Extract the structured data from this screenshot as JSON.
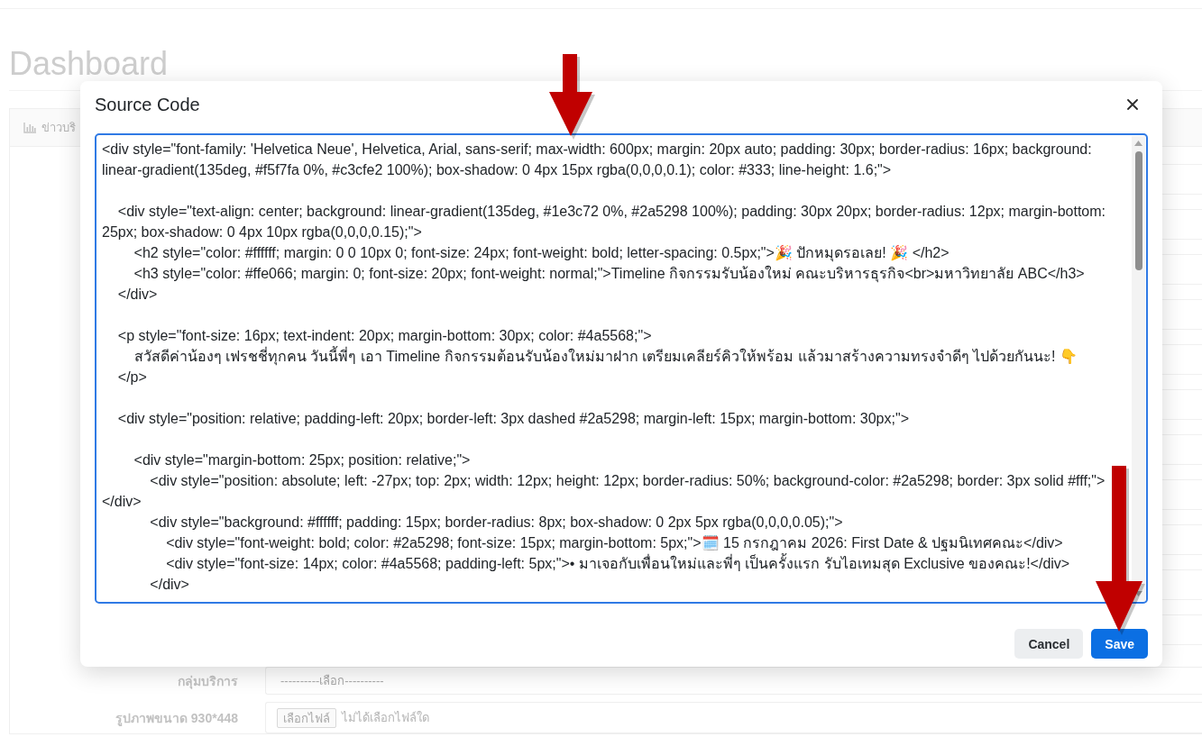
{
  "page": {
    "title": "Dashboard"
  },
  "card": {
    "tab": "ข่าวบริ"
  },
  "form": {
    "rows": [
      {
        "kind": "select",
        "label": "กลุ่มบริการ",
        "value": "----------เลือก----------"
      },
      {
        "kind": "file",
        "label": "รูปภาพขนาด 930*448",
        "button": "เลือกไฟล์",
        "status": "ไม่ได้เลือกไฟล์ใด"
      }
    ]
  },
  "dialog": {
    "title": "Source Code",
    "code_blocks": [
      [
        "<div style=\"font-family: 'Helvetica Neue', Helvetica, Arial, sans-serif; max-width: 600px; margin: 20px auto; padding: 30px; border-radius: 16px; background: linear-gradient(135deg, #f5f7fa 0%, #c3cfe2 100%); box-shadow: 0 4px 15px rgba(0,0,0,0.1); color: #333; line-height: 1.6;\">"
      ],
      [
        "    <div style=\"text-align: center; background: linear-gradient(135deg, #1e3c72 0%, #2a5298 100%); padding: 30px 20px; border-radius: 12px; margin-bottom: 25px; box-shadow: 0 4px 10px rgba(0,0,0,0.15);\">",
        "        <h2 style=\"color: #ffffff; margin: 0 0 10px 0; font-size: 24px; font-weight: bold; letter-spacing: 0.5px;\">🎉 ปักหมุดรอเลย! 🎉 </h2>",
        "        <h3 style=\"color: #ffe066; margin: 0; font-size: 20px; font-weight: normal;\">Timeline กิจกรรมรับน้องใหม่ คณะบริหารธุรกิจ<br>มหาวิทยาลัย ABC</h3>",
        "    </div>"
      ],
      [
        "    <p style=\"font-size: 16px; text-indent: 20px; margin-bottom: 30px; color: #4a5568;\">",
        "        สวัสดีค่าน้องๆ เฟรชชี่ทุกคน วันนี้พี่ๆ เอา Timeline กิจกรรมต้อนรับน้องใหม่มาฝาก เตรียมเคลียร์คิวให้พร้อม แล้วมาสร้างความทรงจำดีๆ ไปด้วยกันนะ! 👇",
        "    </p>"
      ],
      [
        "    <div style=\"position: relative; padding-left: 20px; border-left: 3px dashed #2a5298; margin-left: 15px; margin-bottom: 30px;\">"
      ],
      [
        "        <div style=\"margin-bottom: 25px; position: relative;\">",
        "            <div style=\"position: absolute; left: -27px; top: 2px; width: 12px; height: 12px; border-radius: 50%; background-color: #2a5298; border: 3px solid #fff;\"></div>",
        "            <div style=\"background: #ffffff; padding: 15px; border-radius: 8px; box-shadow: 0 2px 5px rgba(0,0,0,0.05);\">",
        "                <div style=\"font-weight: bold; color: #2a5298; font-size: 15px; margin-bottom: 5px;\">🗓️ 15 กรกฎาคม 2026: First Date & ปฐมนิเทศคณะ</div>",
        "                <div style=\"font-size: 14px; color: #4a5568; padding-left: 5px;\">• มาเจอกับเพื่อนใหม่และพี่ๆ เป็นครั้งแรก รับไอเทมสุด Exclusive ของคณะ!</div>",
        "            </div>"
      ]
    ],
    "buttons": [
      {
        "kind": "secondary",
        "label": "Cancel"
      },
      {
        "kind": "primary",
        "label": "Save"
      }
    ]
  }
}
